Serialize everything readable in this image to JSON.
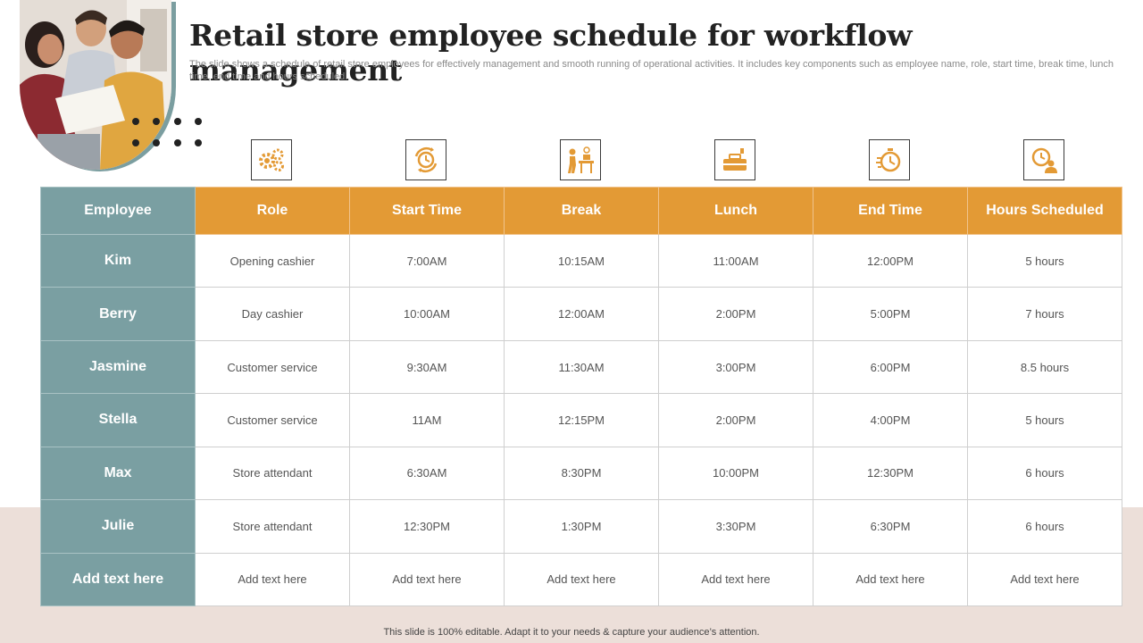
{
  "slide": {
    "title": "Retail store employee schedule for workflow management",
    "subtitle": "The slide shows a schedule of retail store employees for effectively management and smooth running of operational activities. It includes key components such as employee name, role, start time, break time, lunch time, end time and hours scheduled.",
    "footer": "This slide is 100% editable. Adapt it to your needs & capture your audience’s attention."
  },
  "colors": {
    "accent_orange": "#e39a35",
    "accent_teal": "#7a9fa2",
    "band": "#ecdfd9"
  },
  "icons": [
    "gears-icon",
    "clock-cycle-icon",
    "person-desk-icon",
    "lunch-box-icon",
    "stopwatch-icon",
    "clock-person-icon"
  ],
  "table": {
    "headers": [
      "Employee",
      "Role",
      "Start Time",
      "Break",
      "Lunch",
      "End Time",
      "Hours Scheduled"
    ],
    "rows": [
      [
        "Kim",
        "Opening cashier",
        "7:00AM",
        "10:15AM",
        "11:00AM",
        "12:00PM",
        "5 hours"
      ],
      [
        "Berry",
        "Day cashier",
        "10:00AM",
        "12:00AM",
        "2:00PM",
        "5:00PM",
        "7 hours"
      ],
      [
        "Jasmine",
        "Customer service",
        "9:30AM",
        "11:30AM",
        "3:00PM",
        "6:00PM",
        "8.5 hours"
      ],
      [
        "Stella",
        "Customer service",
        "11AM",
        "12:15PM",
        "2:00PM",
        "4:00PM",
        "5 hours"
      ],
      [
        "Max",
        "Store attendant",
        "6:30AM",
        "8:30PM",
        "10:00PM",
        "12:30PM",
        "6 hours"
      ],
      [
        "Julie",
        "Store attendant",
        "12:30PM",
        "1:30PM",
        "3:30PM",
        "6:30PM",
        "6 hours"
      ],
      [
        "Add text here",
        "Add text here",
        "Add text here",
        "Add text here",
        "Add text here",
        "Add text here",
        "Add text here"
      ]
    ]
  }
}
